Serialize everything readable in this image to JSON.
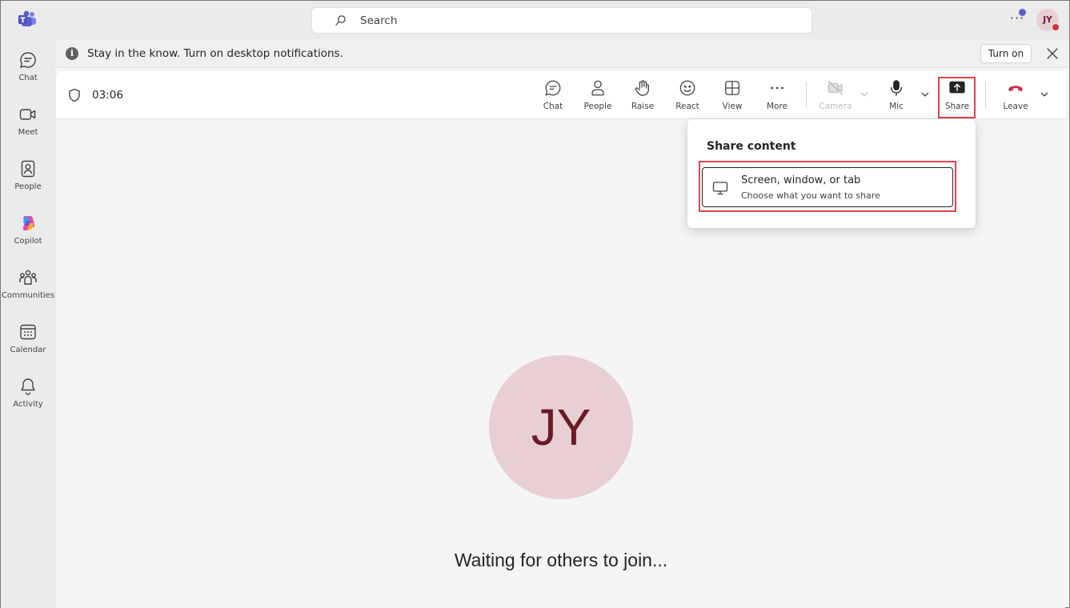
{
  "rail": {
    "items": [
      {
        "label": "Chat",
        "icon": "chat-icon"
      },
      {
        "label": "Meet",
        "icon": "video-icon"
      },
      {
        "label": "People",
        "icon": "people-icon"
      },
      {
        "label": "Copilot",
        "icon": "copilot-icon"
      },
      {
        "label": "Communities",
        "icon": "communities-icon"
      },
      {
        "label": "Calendar",
        "icon": "calendar-icon"
      },
      {
        "label": "Activity",
        "icon": "bell-icon"
      }
    ]
  },
  "topbar": {
    "search_placeholder": "Search",
    "more": "···",
    "avatar_initials": "JY"
  },
  "banner": {
    "info_glyph": "i",
    "message": "Stay in the know. Turn on desktop notifications.",
    "turn_on_label": "Turn on"
  },
  "meeting": {
    "timer": "03:06",
    "controls": {
      "chat": "Chat",
      "people": "People",
      "raise": "Raise",
      "react": "React",
      "view": "View",
      "more": "More",
      "camera": "Camera",
      "mic": "Mic",
      "share": "Share",
      "leave": "Leave"
    },
    "participant_initials": "JY",
    "waiting_text": "Waiting for others to join..."
  },
  "share_popup": {
    "title": "Share content",
    "option_title": "Screen, window, or tab",
    "option_subtitle": "Choose what you want to share"
  },
  "colors": {
    "accent": "#5b5fc7",
    "leave_red": "#c4314b",
    "highlight_red": "#e0464c",
    "avatar_bg": "#e8cfd3",
    "avatar_text": "#6b1a26"
  }
}
